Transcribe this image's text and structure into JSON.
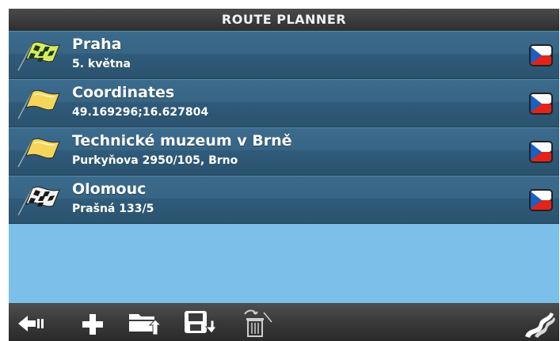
{
  "header": {
    "title": "ROUTE PLANNER"
  },
  "route_points": [
    {
      "name": "Praha",
      "address": "5. května",
      "flag": "checkered-green-flag-icon",
      "country": "czech-flag-icon"
    },
    {
      "name": "Coordinates",
      "address": "49.169296;16.627804",
      "flag": "yellow-flag-icon",
      "country": "czech-flag-icon"
    },
    {
      "name": "Technické muzeum v Brně",
      "address": "Purkyňova 2950/105, Brno",
      "flag": "yellow-flag-icon",
      "country": "czech-flag-icon"
    },
    {
      "name": "Olomouc",
      "address": "Prašná 133/5",
      "flag": "checkered-finish-flag-icon",
      "country": "czech-flag-icon"
    }
  ],
  "toolbar": {
    "buttons": [
      "back-icon",
      "add-icon",
      "open-folder-icon",
      "save-icon",
      "delete-icon",
      "road-icon"
    ]
  },
  "colors": {
    "background": "#7cc0ea",
    "row": "#386585",
    "toolbar": "#3b3b3b"
  }
}
